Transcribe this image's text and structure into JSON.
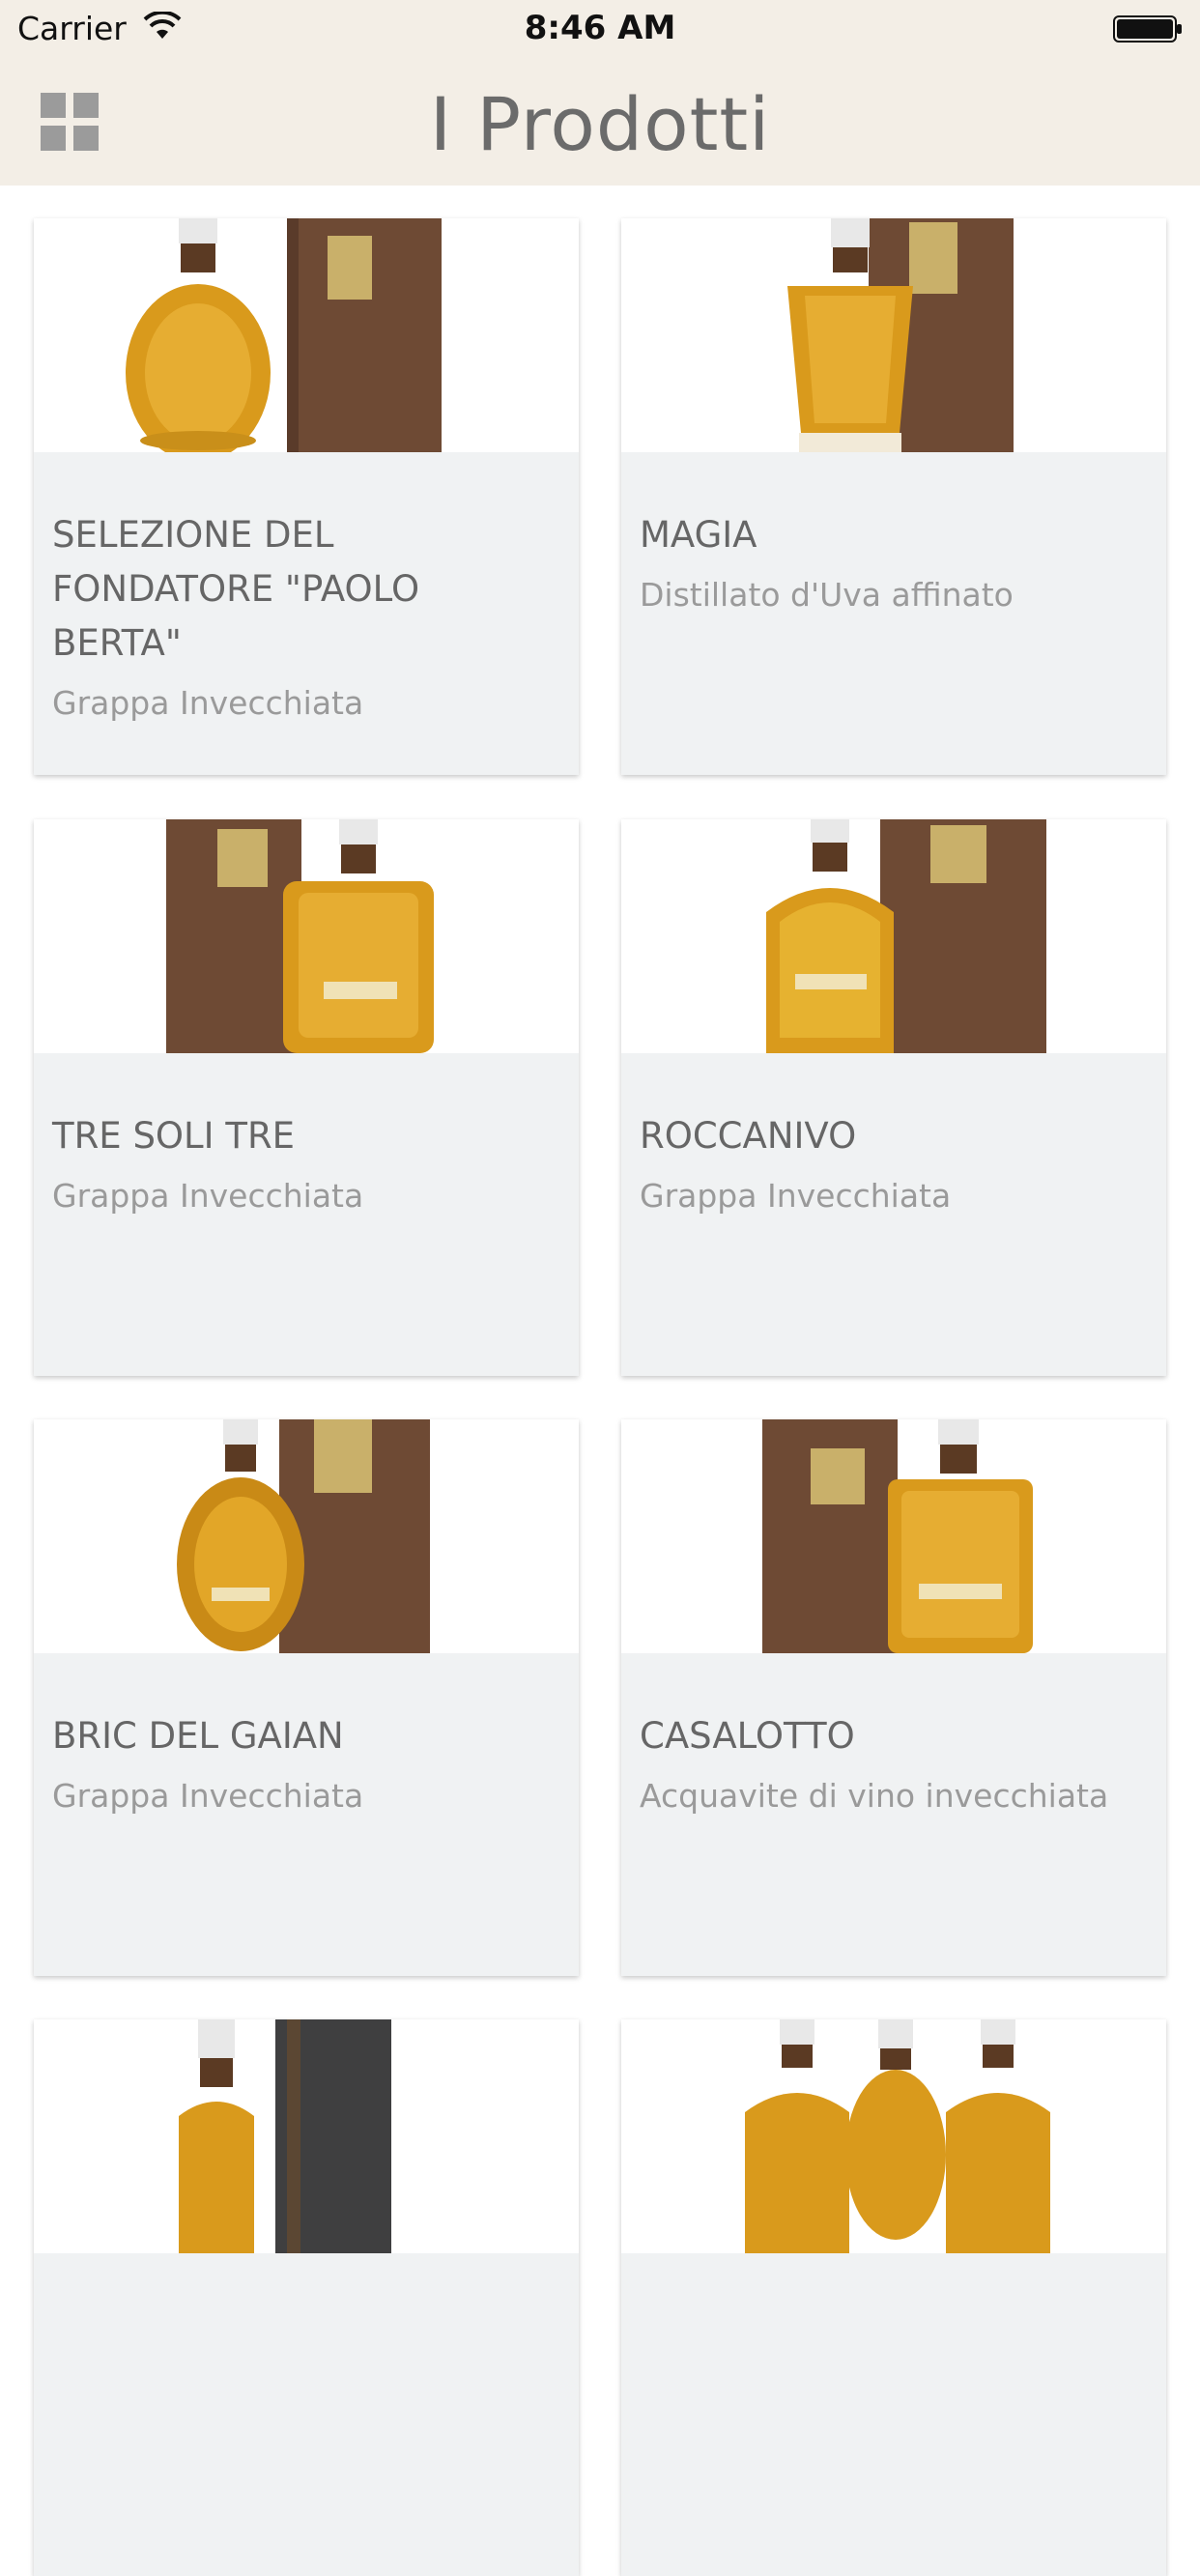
{
  "status_bar": {
    "carrier": "Carrier",
    "time": "8:46 AM"
  },
  "nav": {
    "title": "I Prodotti",
    "menu_icon": "grid-icon"
  },
  "products": [
    {
      "name": "SELEZIONE DEL FONDATORE \"PAOLO BERTA\"",
      "subtitle": "Grappa Invecchiata"
    },
    {
      "name": "MAGIA",
      "subtitle": "Distillato d'Uva affinato"
    },
    {
      "name": "TRE SOLI TRE",
      "subtitle": "Grappa Invecchiata"
    },
    {
      "name": "ROCCANIVO",
      "subtitle": "Grappa Invecchiata"
    },
    {
      "name": "BRIC DEL GAIAN",
      "subtitle": "Grappa Invecchiata"
    },
    {
      "name": "CASALOTTO",
      "subtitle": "Acquavite di vino invecchiata"
    }
  ],
  "colors": {
    "bar": "#f3eee6",
    "card": "#f0f2f3",
    "liquor": "#d99a1c",
    "box": "#6e4a34"
  }
}
